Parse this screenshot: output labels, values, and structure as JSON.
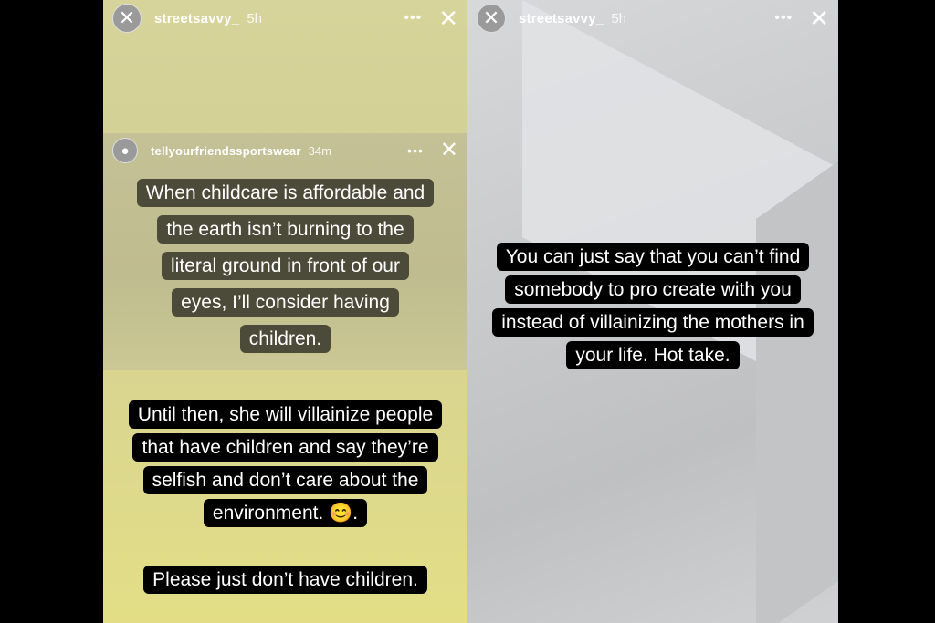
{
  "left_story": {
    "username": "streetsavvy_",
    "time": "5h",
    "more_label": "•••",
    "close_label": "✕",
    "embedded_story": {
      "username": "tellyourfriendssportswear",
      "time": "34m",
      "more_label": "•••",
      "close_label": "✕",
      "caption_lines": [
        "When childcare is affordable and",
        "the earth isn’t burning to the",
        "literal ground in front of our",
        "eyes, I’ll consider having",
        "children."
      ]
    },
    "caption_2_lines": [
      "Until then, she will villainize people",
      "that have children and say they’re",
      "selfish and don’t care about the",
      "environment. 😊."
    ],
    "caption_3": "Please just don’t have children."
  },
  "right_story": {
    "username": "streetsavvy_",
    "time": "5h",
    "more_label": "•••",
    "close_label": "✕",
    "caption_lines": [
      "You can just say that you can’t find",
      "somebody to pro create with you",
      "instead of villainizing the mothers in",
      "your life. Hot take."
    ]
  },
  "icons": {
    "avatar": "avatar-icon",
    "more": "more-options-icon",
    "close": "close-icon"
  }
}
